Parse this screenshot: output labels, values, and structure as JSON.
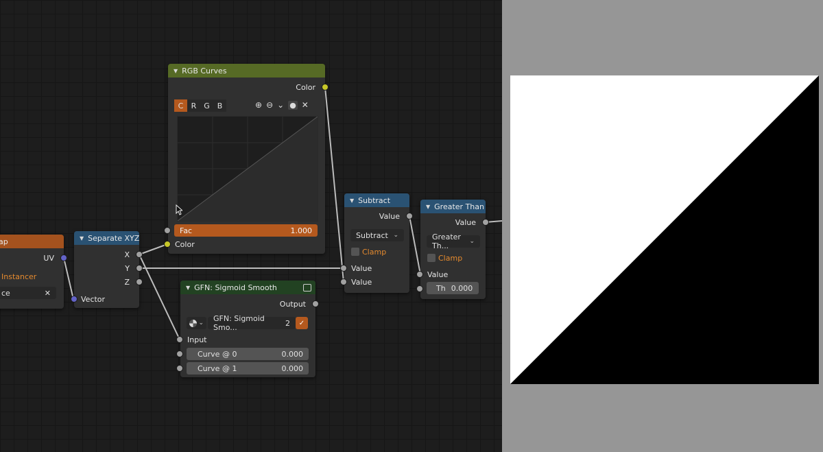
{
  "nodes": {
    "uvmap": {
      "title": "ap",
      "out_uv": "UV",
      "from_instancer": "Instancer",
      "field_value": "ce",
      "clear": "✕"
    },
    "separate": {
      "title": "Separate XYZ",
      "out_x": "X",
      "out_y": "Y",
      "out_z": "Z",
      "in_vector": "Vector"
    },
    "curves": {
      "title": "RGB Curves",
      "out_color": "Color",
      "tabs": [
        "C",
        "R",
        "G",
        "B"
      ],
      "tools": {
        "zoom_in": "⊕",
        "zoom_out": "⊖",
        "menu": "⌄",
        "dot": "●",
        "reset": "✕"
      },
      "fac_label": "Fac",
      "fac_value": "1.000",
      "in_color": "Color"
    },
    "sigmoid": {
      "title": "GFN: Sigmoid Smooth",
      "out_output": "Output",
      "group_name": "GFN: Sigmoid Smo...",
      "users": "2",
      "in_input": "Input",
      "curve0_label": "Curve @ 0",
      "curve0_value": "0.000",
      "curve1_label": "Curve @ 1",
      "curve1_value": "0.000"
    },
    "subtract": {
      "title": "Subtract",
      "out_value": "Value",
      "operation": "Subtract",
      "clamp": "Clamp",
      "in_value1": "Value",
      "in_value2": "Value"
    },
    "greater": {
      "title": "Greater Than",
      "out_value": "Value",
      "operation": "Greater Th...",
      "clamp": "Clamp",
      "in_value": "Value",
      "th_label": "Th",
      "th_value": "0.000"
    }
  },
  "colors": {
    "header_color": "#566a25",
    "header_vector": "#2a5273",
    "header_input": "#a4521e",
    "accent_orange": "#b5591e",
    "socket_color": "#c7c729",
    "socket_vector": "#6363c7",
    "socket_value": "#a1a1a1"
  }
}
